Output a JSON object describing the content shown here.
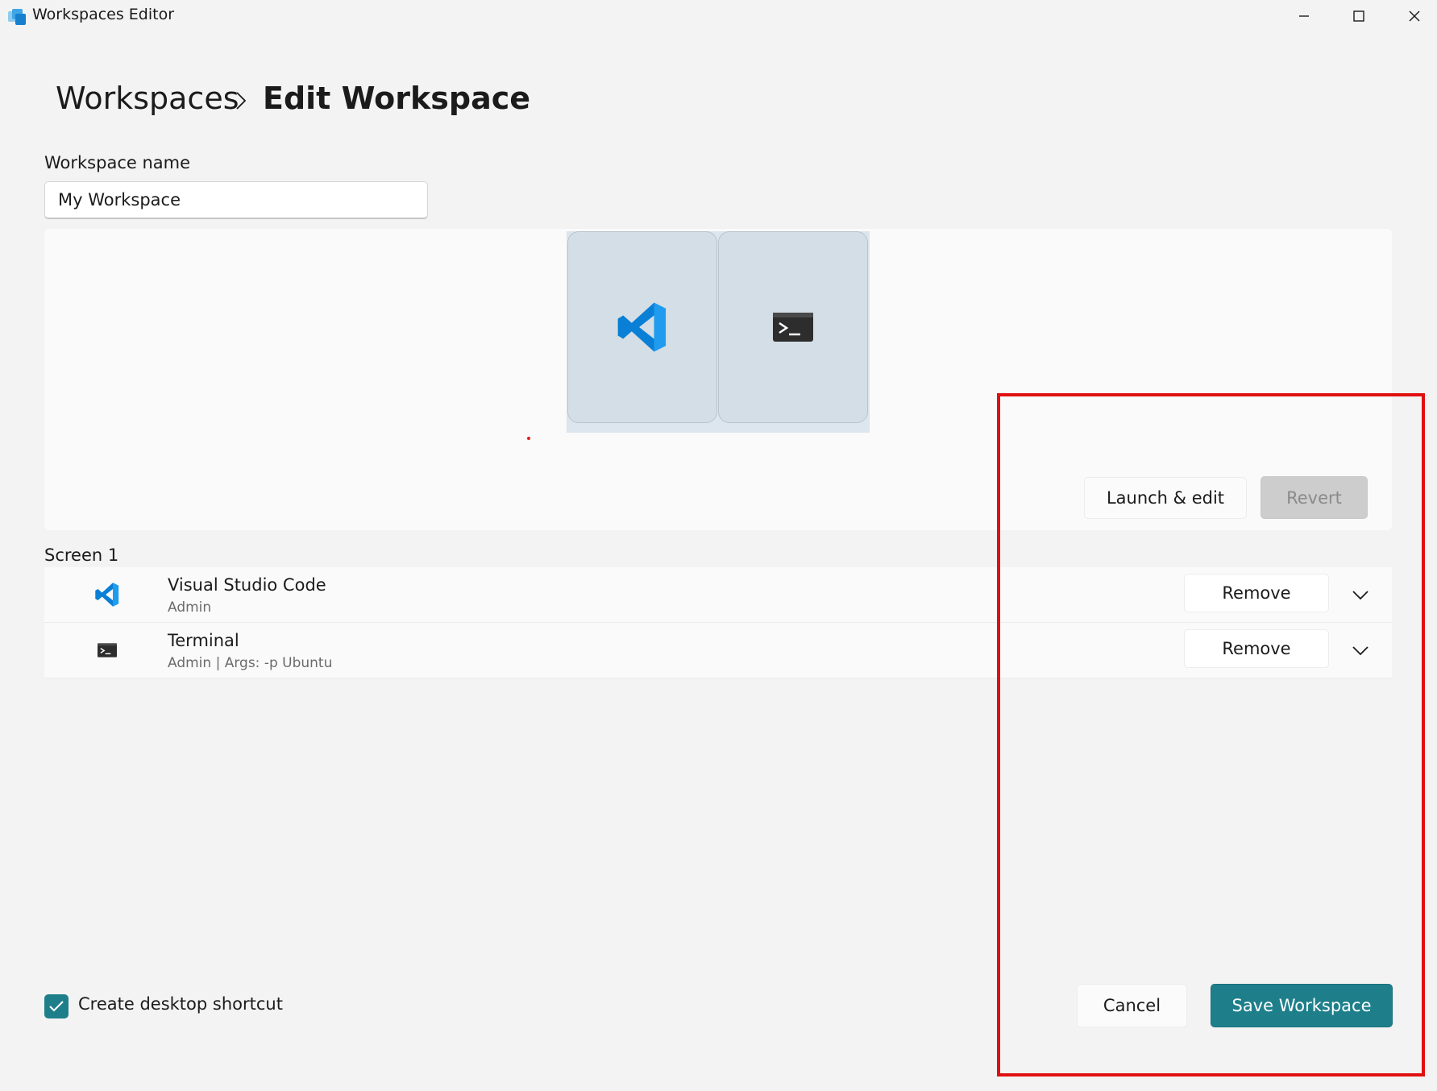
{
  "window": {
    "title": "Workspaces Editor",
    "icons": {
      "app": "workspaces-app-icon",
      "minimize": "minimize-icon",
      "maximize": "maximize-icon",
      "close": "close-icon"
    }
  },
  "breadcrumb": {
    "root": "Workspaces",
    "separator_icon": "chevron-right-icon",
    "current": "Edit Workspace"
  },
  "workspace_name": {
    "label": "Workspace name",
    "value": "My Workspace"
  },
  "preview": {
    "tiles": [
      {
        "app": "Visual Studio Code",
        "icon": "vscode-icon"
      },
      {
        "app": "Terminal",
        "icon": "terminal-icon"
      }
    ],
    "launch_edit_label": "Launch & edit",
    "revert_label": "Revert"
  },
  "screen": {
    "label": "Screen 1",
    "apps": [
      {
        "name": "Visual Studio Code",
        "subtitle": "Admin",
        "icon": "vscode-icon",
        "remove_label": "Remove",
        "expand_icon": "chevron-down-icon"
      },
      {
        "name": "Terminal",
        "subtitle": "Admin | Args: -p Ubuntu",
        "icon": "terminal-icon",
        "remove_label": "Remove",
        "expand_icon": "chevron-down-icon"
      }
    ]
  },
  "footer": {
    "shortcut_label": "Create desktop shortcut",
    "shortcut_checked": true,
    "cancel_label": "Cancel",
    "save_label": "Save Workspace"
  },
  "colors": {
    "accent": "#1e7f8b",
    "background": "#f3f3f3",
    "annotation": "#e01010",
    "vscode_blue": "#0a7fd6"
  }
}
